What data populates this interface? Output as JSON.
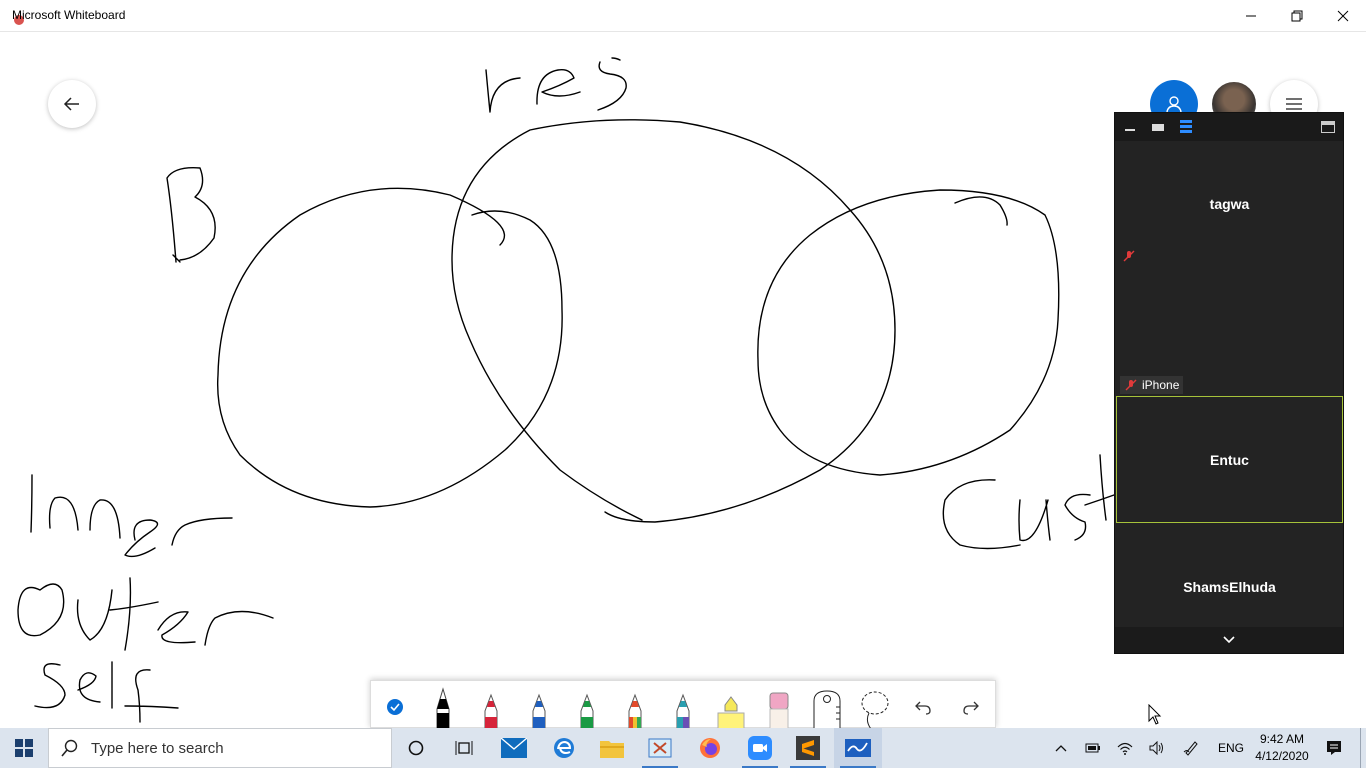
{
  "window": {
    "title": "Microsoft Whiteboard"
  },
  "zoom": {
    "participants": [
      {
        "name": "tagwa",
        "muted": true
      },
      {
        "name": "",
        "label": "iPhone",
        "muted": true
      },
      {
        "name": "Entuc",
        "active": true
      },
      {
        "name": "ShamsElhuda",
        "muted": true
      }
    ]
  },
  "toolbar": {
    "tools": [
      "ink-select",
      "black-pen",
      "red-pen",
      "blue-pen",
      "green-pen",
      "rainbow-pen",
      "galaxy-pen",
      "highlighter",
      "eraser",
      "ruler",
      "lasso",
      "undo",
      "redo"
    ]
  },
  "taskbar": {
    "search_placeholder": "Type here to search",
    "language": "ENG",
    "time": "9:42 AM",
    "date": "4/12/2020"
  },
  "colors": {
    "accent": "#0a6fd6",
    "active_speaker": "#a6c33a",
    "panel_bg": "#232323"
  }
}
